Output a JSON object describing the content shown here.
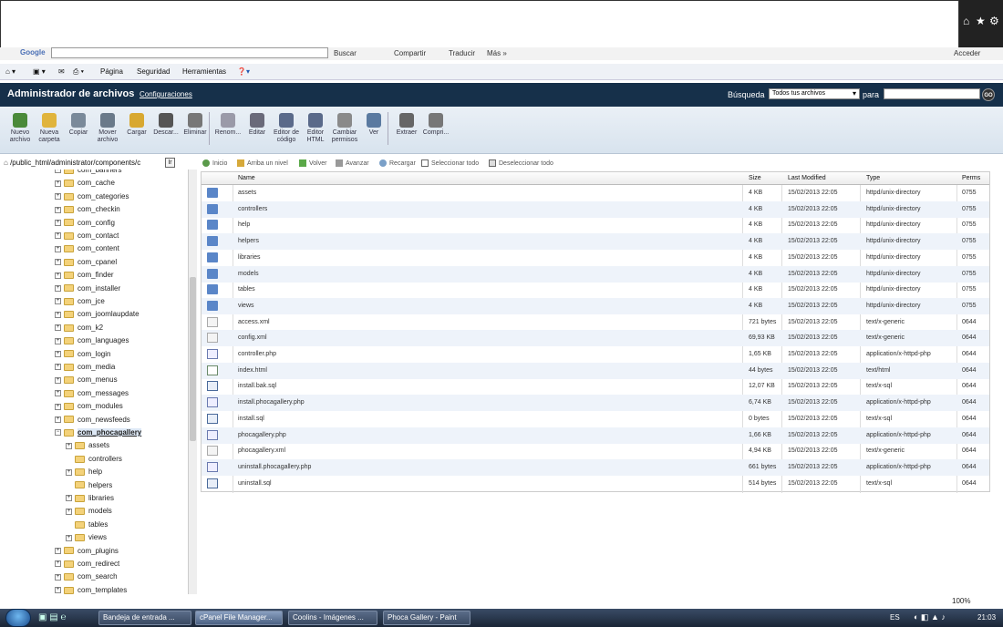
{
  "browser": {
    "google_label": "Google",
    "buscar": "Buscar",
    "compartir": "Compartir",
    "traducir": "Traducir",
    "mas": "Más »",
    "acceder": "Acceder",
    "pagina": "Página",
    "seguridad": "Seguridad",
    "herramientas": "Herramientas"
  },
  "header": {
    "title": "Administrador de archivos",
    "settings": "Configuraciones",
    "search_label": "Búsqueda",
    "search_scope": "Todos tus archivos",
    "para": "para",
    "go": "GO"
  },
  "toolbar": [
    {
      "label": "Nuevo archivo",
      "icon": "new-file-icon"
    },
    {
      "label": "Nueva carpeta",
      "icon": "new-folder-icon"
    },
    {
      "label": "Copiar",
      "icon": "copy-icon"
    },
    {
      "label": "Mover archivo",
      "icon": "move-icon"
    },
    {
      "label": "Cargar",
      "icon": "upload-icon"
    },
    {
      "label": "Descar...",
      "icon": "download-icon"
    },
    {
      "label": "Eliminar",
      "icon": "delete-icon"
    },
    {
      "label": "Renom...",
      "icon": "rename-icon"
    },
    {
      "label": "Editar",
      "icon": "edit-icon"
    },
    {
      "label": "Editor de código",
      "icon": "code-editor-icon"
    },
    {
      "label": "Editor HTML",
      "icon": "html-editor-icon"
    },
    {
      "label": "Cambiar permisos",
      "icon": "permissions-icon"
    },
    {
      "label": "Ver",
      "icon": "view-icon"
    },
    {
      "label": "Extraer",
      "icon": "extract-icon"
    },
    {
      "label": "Compri...",
      "icon": "compress-icon"
    }
  ],
  "path": "/public_html/administrator/components/c",
  "path_button": "Ir",
  "nav": {
    "inicio": "Inicio",
    "arriba": "Arriba un nivel",
    "volver": "Volver",
    "avanzar": "Avanzar",
    "recargar": "Recargar",
    "seleccionar": "Seleccionar todo",
    "deseleccionar": "Deseleccionar todo"
  },
  "tree": [
    {
      "label": "com_banners",
      "lvl": 0,
      "pm": "+"
    },
    {
      "label": "com_cache",
      "lvl": 0,
      "pm": "+"
    },
    {
      "label": "com_categories",
      "lvl": 0,
      "pm": "+"
    },
    {
      "label": "com_checkin",
      "lvl": 0,
      "pm": "+"
    },
    {
      "label": "com_config",
      "lvl": 0,
      "pm": "+"
    },
    {
      "label": "com_contact",
      "lvl": 0,
      "pm": "+"
    },
    {
      "label": "com_content",
      "lvl": 0,
      "pm": "+"
    },
    {
      "label": "com_cpanel",
      "lvl": 0,
      "pm": "+"
    },
    {
      "label": "com_finder",
      "lvl": 0,
      "pm": "+"
    },
    {
      "label": "com_installer",
      "lvl": 0,
      "pm": "+"
    },
    {
      "label": "com_jce",
      "lvl": 0,
      "pm": "+"
    },
    {
      "label": "com_joomlaupdate",
      "lvl": 0,
      "pm": "+"
    },
    {
      "label": "com_k2",
      "lvl": 0,
      "pm": "+"
    },
    {
      "label": "com_languages",
      "lvl": 0,
      "pm": "+"
    },
    {
      "label": "com_login",
      "lvl": 0,
      "pm": "+"
    },
    {
      "label": "com_media",
      "lvl": 0,
      "pm": "+"
    },
    {
      "label": "com_menus",
      "lvl": 0,
      "pm": "+"
    },
    {
      "label": "com_messages",
      "lvl": 0,
      "pm": "+"
    },
    {
      "label": "com_modules",
      "lvl": 0,
      "pm": "+"
    },
    {
      "label": "com_newsfeeds",
      "lvl": 0,
      "pm": "+"
    },
    {
      "label": "com_phocagallery",
      "lvl": 0,
      "pm": "−",
      "selected": true
    },
    {
      "label": "assets",
      "lvl": 1,
      "pm": "+"
    },
    {
      "label": "controllers",
      "lvl": 1,
      "pm": ""
    },
    {
      "label": "help",
      "lvl": 1,
      "pm": "+"
    },
    {
      "label": "helpers",
      "lvl": 1,
      "pm": ""
    },
    {
      "label": "libraries",
      "lvl": 1,
      "pm": "+"
    },
    {
      "label": "models",
      "lvl": 1,
      "pm": "+"
    },
    {
      "label": "tables",
      "lvl": 1,
      "pm": ""
    },
    {
      "label": "views",
      "lvl": 1,
      "pm": "+"
    },
    {
      "label": "com_plugins",
      "lvl": 0,
      "pm": "+"
    },
    {
      "label": "com_redirect",
      "lvl": 0,
      "pm": "+"
    },
    {
      "label": "com_search",
      "lvl": 0,
      "pm": "+"
    },
    {
      "label": "com_templates",
      "lvl": 0,
      "pm": "+"
    }
  ],
  "columns": {
    "name": "Name",
    "size": "Size",
    "modified": "Last Modified",
    "type": "Type",
    "perms": "Perms"
  },
  "files": [
    {
      "name": "assets",
      "size": "4 KB",
      "modified": "15/02/2013 22:05",
      "type": "httpd/unix-directory",
      "perms": "0755",
      "icon": "folder"
    },
    {
      "name": "controllers",
      "size": "4 KB",
      "modified": "15/02/2013 22:05",
      "type": "httpd/unix-directory",
      "perms": "0755",
      "icon": "folder"
    },
    {
      "name": "help",
      "size": "4 KB",
      "modified": "15/02/2013 22:05",
      "type": "httpd/unix-directory",
      "perms": "0755",
      "icon": "folder"
    },
    {
      "name": "helpers",
      "size": "4 KB",
      "modified": "15/02/2013 22:05",
      "type": "httpd/unix-directory",
      "perms": "0755",
      "icon": "folder"
    },
    {
      "name": "libraries",
      "size": "4 KB",
      "modified": "15/02/2013 22:05",
      "type": "httpd/unix-directory",
      "perms": "0755",
      "icon": "folder"
    },
    {
      "name": "models",
      "size": "4 KB",
      "modified": "15/02/2013 22:05",
      "type": "httpd/unix-directory",
      "perms": "0755",
      "icon": "folder"
    },
    {
      "name": "tables",
      "size": "4 KB",
      "modified": "15/02/2013 22:05",
      "type": "httpd/unix-directory",
      "perms": "0755",
      "icon": "folder"
    },
    {
      "name": "views",
      "size": "4 KB",
      "modified": "15/02/2013 22:05",
      "type": "httpd/unix-directory",
      "perms": "0755",
      "icon": "folder"
    },
    {
      "name": "access.xml",
      "size": "721 bytes",
      "modified": "15/02/2013 22:05",
      "type": "text/x-generic",
      "perms": "0644",
      "icon": "generic"
    },
    {
      "name": "config.xml",
      "size": "69,93 KB",
      "modified": "15/02/2013 22:05",
      "type": "text/x-generic",
      "perms": "0644",
      "icon": "generic"
    },
    {
      "name": "controller.php",
      "size": "1,65 KB",
      "modified": "15/02/2013 22:05",
      "type": "application/x-httpd-php",
      "perms": "0644",
      "icon": "php"
    },
    {
      "name": "index.html",
      "size": "44 bytes",
      "modified": "15/02/2013 22:05",
      "type": "text/html",
      "perms": "0644",
      "icon": "html"
    },
    {
      "name": "install.bak.sql",
      "size": "12,07 KB",
      "modified": "15/02/2013 22:05",
      "type": "text/x-sql",
      "perms": "0644",
      "icon": "sql"
    },
    {
      "name": "install.phocagallery.php",
      "size": "6,74 KB",
      "modified": "15/02/2013 22:05",
      "type": "application/x-httpd-php",
      "perms": "0644",
      "icon": "php"
    },
    {
      "name": "install.sql",
      "size": "0 bytes",
      "modified": "15/02/2013 22:05",
      "type": "text/x-sql",
      "perms": "0644",
      "icon": "sql"
    },
    {
      "name": "phocagallery.php",
      "size": "1,66 KB",
      "modified": "15/02/2013 22:05",
      "type": "application/x-httpd-php",
      "perms": "0644",
      "icon": "php"
    },
    {
      "name": "phocagallery.xml",
      "size": "4,94 KB",
      "modified": "15/02/2013 22:05",
      "type": "text/x-generic",
      "perms": "0644",
      "icon": "generic"
    },
    {
      "name": "uninstall.phocagallery.php",
      "size": "661 bytes",
      "modified": "15/02/2013 22:05",
      "type": "application/x-httpd-php",
      "perms": "0644",
      "icon": "php"
    },
    {
      "name": "uninstall.sql",
      "size": "514 bytes",
      "modified": "15/02/2013 22:05",
      "type": "text/x-sql",
      "perms": "0644",
      "icon": "sql"
    }
  ],
  "zoom": "100%",
  "taskbar": [
    {
      "label": "Bandeja de entrada ..."
    },
    {
      "label": "cPanel File Manager...",
      "active": true
    },
    {
      "label": "Coolins - Imágenes ..."
    },
    {
      "label": "Phoca Gallery - Paint"
    }
  ],
  "tray": {
    "lang": "ES",
    "time": "21:03"
  }
}
